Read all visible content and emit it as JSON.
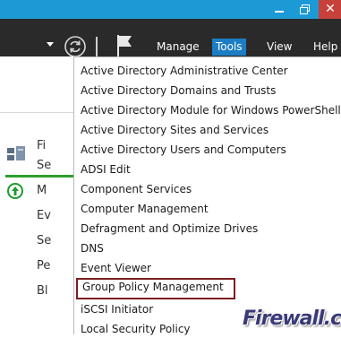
{
  "window": {
    "close_glyph": "✕",
    "controls": [
      "minimize-icon",
      "restore-icon",
      "close-icon"
    ]
  },
  "toolbar": {
    "menus": [
      {
        "label": "Manage",
        "active": false
      },
      {
        "label": "Tools",
        "active": true
      },
      {
        "label": "View",
        "active": false
      },
      {
        "label": "Help",
        "active": false
      }
    ],
    "icons": [
      "chevron-down-icon",
      "refresh-icon",
      "flag-icon"
    ]
  },
  "background": {
    "partial_labels": [
      "Fi",
      "Se",
      "M",
      "Ev",
      "Se",
      "Pe",
      "Bl"
    ]
  },
  "tools_menu": {
    "items": [
      "Active Directory Administrative Center",
      "Active Directory Domains and Trusts",
      "Active Directory Module for Windows PowerShell",
      "Active Directory Sites and Services",
      "Active Directory Users and Computers",
      "ADSI Edit",
      "Component Services",
      "Computer Management",
      "Defragment and Optimize Drives",
      "DNS",
      "Event Viewer",
      "Group Policy Management",
      "iSCSI Initiator",
      "Local Security Policy"
    ],
    "highlighted": "Group Policy Management"
  },
  "watermark": {
    "text": "Firewall.cx"
  },
  "colors": {
    "titlebar": "#1c9ad6",
    "close": "#c7403a",
    "cmdbar": "#2a2a2a",
    "tools_active": "#1c7dc4",
    "highlight_border": "#7a1e22",
    "green": "#2e9e2e"
  }
}
